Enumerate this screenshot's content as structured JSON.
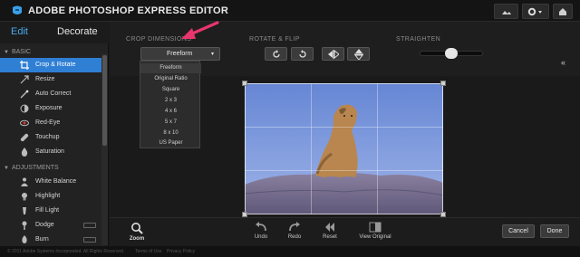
{
  "app": {
    "title": "ADOBE PHOTOSHOP EXPRESS EDITOR"
  },
  "titlebar": {
    "accent": "#3aa0e8",
    "menu_chevron": "▾"
  },
  "sidebar": {
    "tabs": [
      {
        "label": "Edit",
        "active": true
      },
      {
        "label": "Decorate",
        "active": false
      }
    ],
    "sections": [
      {
        "title": "BASIC",
        "items": [
          {
            "label": "Crop & Rotate",
            "icon": "crop-icon",
            "active": true
          },
          {
            "label": "Resize",
            "icon": "resize-icon"
          },
          {
            "label": "Auto Correct",
            "icon": "wand-icon"
          },
          {
            "label": "Exposure",
            "icon": "exposure-icon"
          },
          {
            "label": "Red-Eye",
            "icon": "eye-icon"
          },
          {
            "label": "Touchup",
            "icon": "bandage-icon"
          },
          {
            "label": "Saturation",
            "icon": "drop-icon"
          }
        ]
      },
      {
        "title": "ADJUSTMENTS",
        "items": [
          {
            "label": "White Balance",
            "icon": "person-icon"
          },
          {
            "label": "Highlight",
            "icon": "bulb-icon"
          },
          {
            "label": "Fill Light",
            "icon": "fill-light-icon"
          },
          {
            "label": "Dodge",
            "icon": "dodge-icon"
          },
          {
            "label": "Burn",
            "icon": "burn-icon"
          }
        ]
      }
    ]
  },
  "toolbar": {
    "crop_label": "CROP DIMENSIONS",
    "crop_value": "Freeform",
    "rotate_label": "ROTATE & FLIP",
    "straighten_label": "STRAIGHTEN",
    "straighten_value": 0.5
  },
  "crop_options": [
    "Freeform",
    "Original Ratio",
    "Square",
    "2 x 3",
    "4 x 6",
    "5 x 7",
    "8 x 10",
    "US Paper"
  ],
  "bottombar": {
    "zoom": "Zoom",
    "undo": "Undo",
    "redo": "Redo",
    "reset": "Reset",
    "view_original": "View Original",
    "cancel": "Cancel",
    "done": "Done"
  },
  "footer": {
    "copyright": "© 2011 Adobe Systems Incorporated. All Rights Reserved.",
    "terms": "Terms of Use",
    "privacy": "Privacy Policy"
  },
  "colors": {
    "accent": "#2f7fd4",
    "annotation_arrow": "#e8356d",
    "sky": "#6f8fd6"
  }
}
